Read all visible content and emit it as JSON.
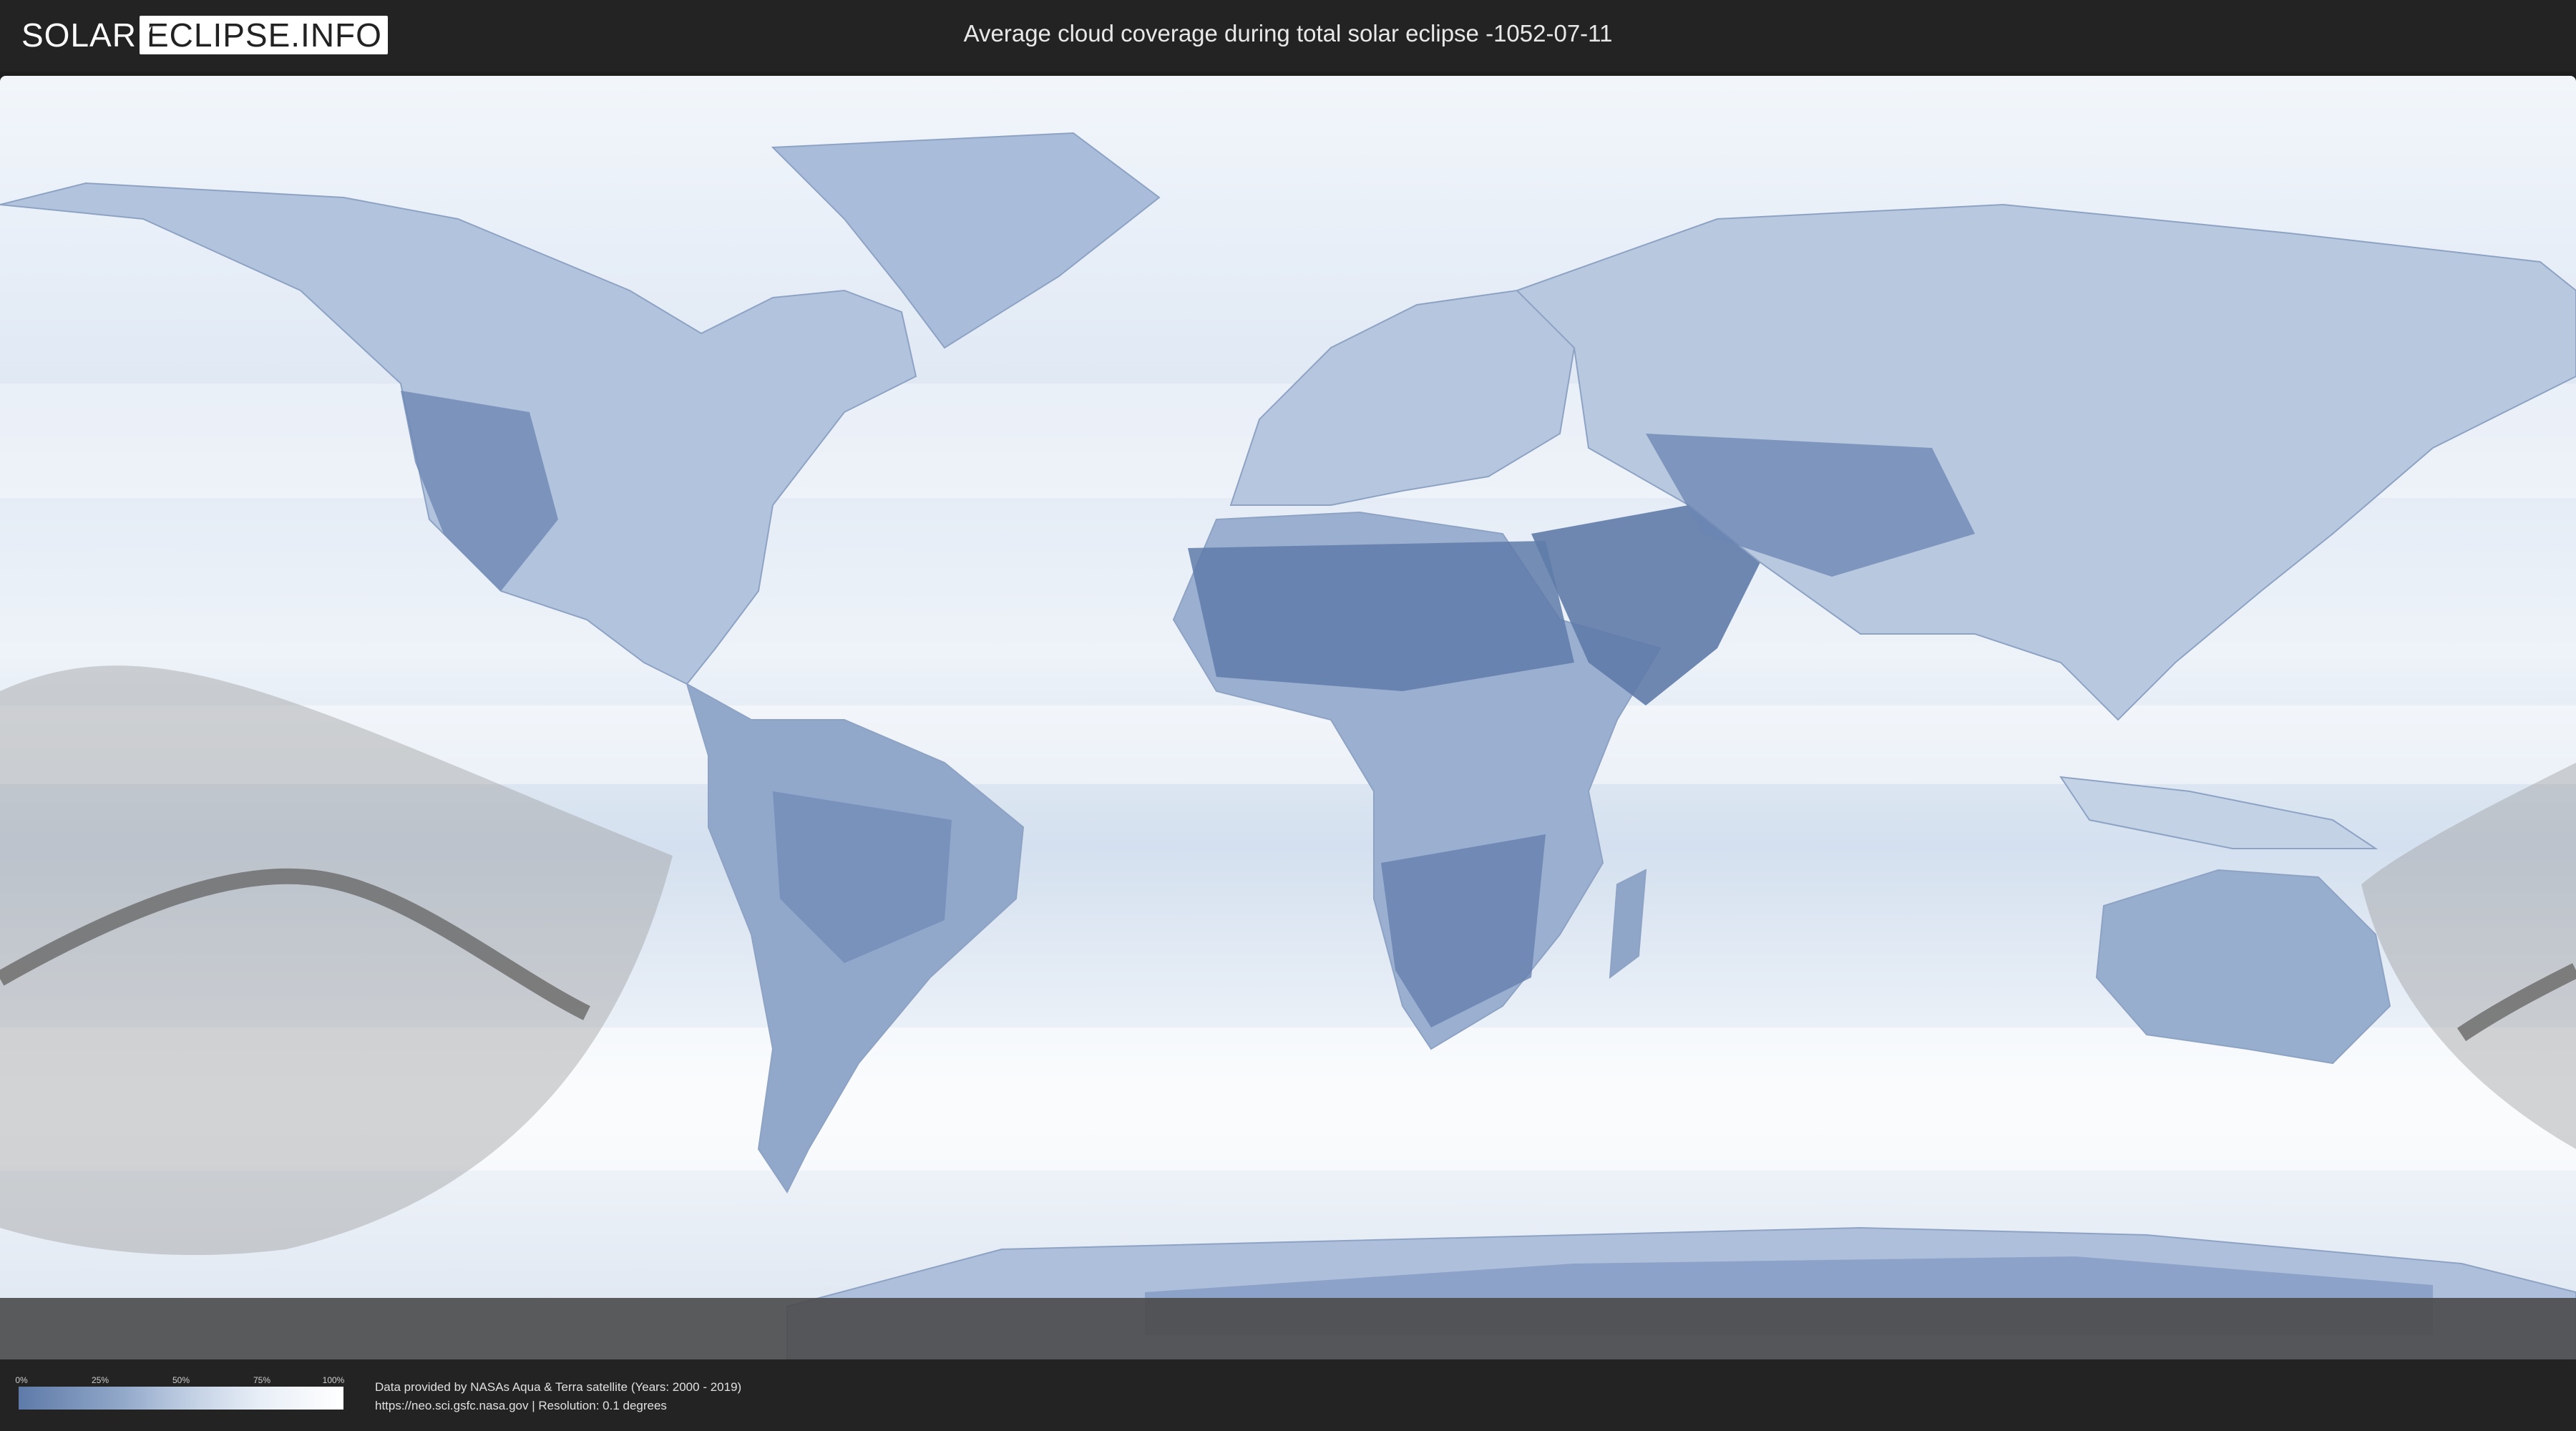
{
  "header": {
    "logo_left": "SOLAR",
    "logo_right": "ECLIPSE.INFO",
    "title": "Average cloud coverage during total solar eclipse -1052-07-11"
  },
  "legend": {
    "ticks": [
      "0%",
      "25%",
      "50%",
      "75%",
      "100%"
    ],
    "colors": {
      "low": "#5e7aa8",
      "high": "#ffffff"
    }
  },
  "footer": {
    "credit_line1": "Data provided by NASAs Aqua & Terra satellite (Years: 2000 - 2019)",
    "credit_line2": "https://neo.sci.gsfc.nasa.gov | Resolution: 0.1 degrees"
  },
  "map": {
    "ocean_color": "#e4ecf6",
    "land_clear_color": "#6f89b5",
    "eclipse_zone_color": "#bdbdbd"
  }
}
